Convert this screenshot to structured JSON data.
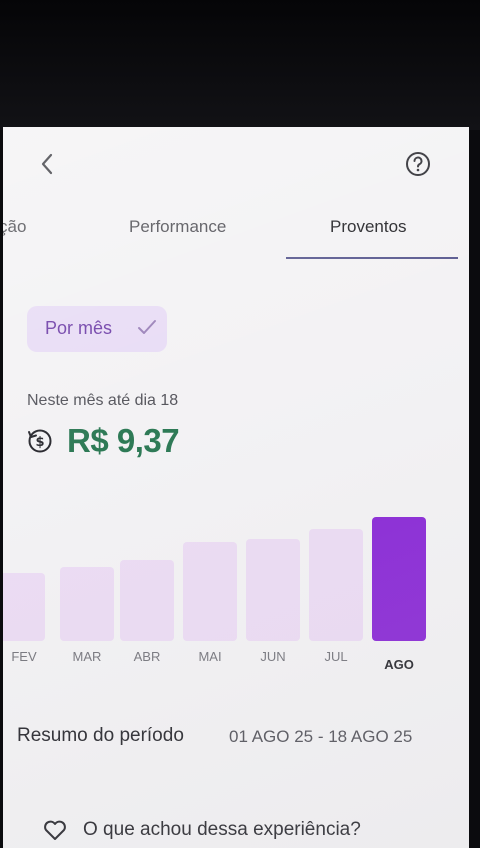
{
  "header": {
    "back_icon": "chevron-left-icon",
    "help_icon": "question-circle-icon"
  },
  "tabs": [
    {
      "label": "ção"
    },
    {
      "label": "Performance"
    },
    {
      "label": "Proventos",
      "active": true
    }
  ],
  "filter": {
    "label": "Por mês",
    "icon": "check-icon"
  },
  "period_caption": "Neste mês até dia 18",
  "amount": "R$ 9,37",
  "chart_data": {
    "type": "bar",
    "categories": [
      "FEV",
      "MAR",
      "ABR",
      "MAI",
      "JUN",
      "JUL",
      "AGO"
    ],
    "values": [
      0.55,
      0.6,
      0.65,
      0.8,
      0.82,
      0.9,
      1.0
    ],
    "highlighted": "AGO"
  },
  "summary": {
    "label": "Resumo do período",
    "range": "01 AGO 25 - 18 AGO 25"
  },
  "feedback": {
    "label": "O que achou dessa experiência?",
    "icon": "heart-icon"
  },
  "colors": {
    "accent": "#8b2bd6",
    "bar_muted": "#ecdcf4",
    "amount": "#2e7a56",
    "chip_bg": "#e8dcf5"
  }
}
